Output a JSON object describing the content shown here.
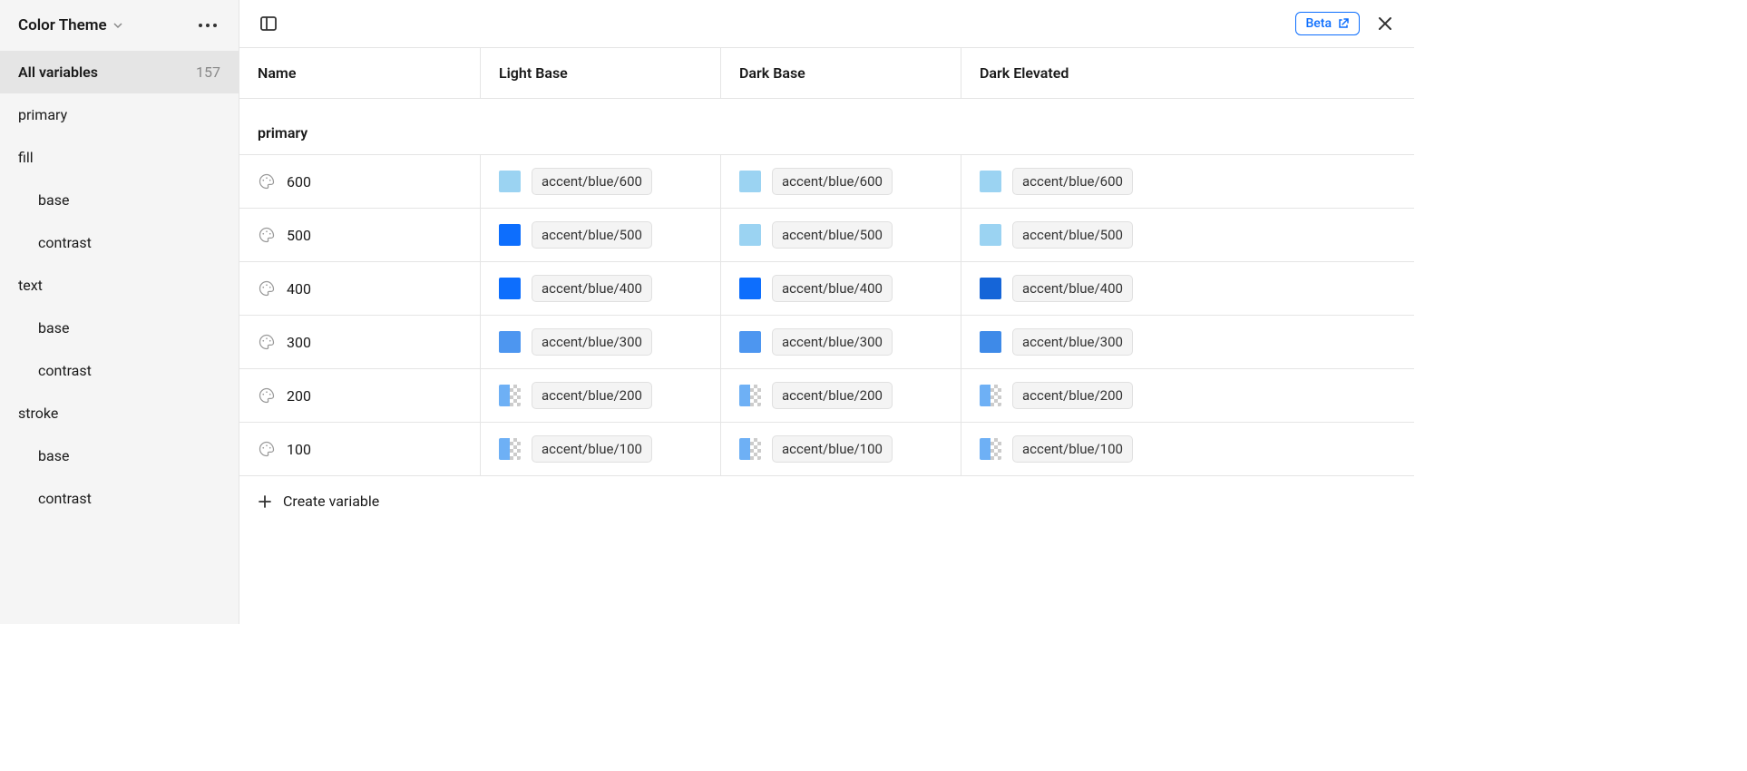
{
  "sidebar": {
    "title": "Color Theme",
    "allVariables": {
      "label": "All variables",
      "count": "157"
    },
    "groups": [
      {
        "label": "primary",
        "indent": 0
      },
      {
        "label": "fill",
        "indent": 0
      },
      {
        "label": "base",
        "indent": 1
      },
      {
        "label": "contrast",
        "indent": 1
      },
      {
        "label": "text",
        "indent": 0
      },
      {
        "label": "base",
        "indent": 1
      },
      {
        "label": "contrast",
        "indent": 1
      },
      {
        "label": "stroke",
        "indent": 0
      },
      {
        "label": "base",
        "indent": 1
      },
      {
        "label": "contrast",
        "indent": 1
      }
    ]
  },
  "topbar": {
    "beta": "Beta"
  },
  "table": {
    "columns": [
      "Name",
      "Light Base",
      "Dark Base",
      "Dark Elevated"
    ],
    "groupTitle": "primary",
    "createLabel": "Create variable",
    "rows": [
      {
        "name": "600",
        "modes": [
          {
            "color": "#9bd3f2",
            "alpha": false,
            "token": "accent/blue/600"
          },
          {
            "color": "#9bd3f2",
            "alpha": false,
            "token": "accent/blue/600"
          },
          {
            "color": "#9bd3f2",
            "alpha": false,
            "token": "accent/blue/600"
          }
        ]
      },
      {
        "name": "500",
        "modes": [
          {
            "color": "#0d6efd",
            "alpha": false,
            "token": "accent/blue/500"
          },
          {
            "color": "#9bd3f2",
            "alpha": false,
            "token": "accent/blue/500"
          },
          {
            "color": "#9bd3f2",
            "alpha": false,
            "token": "accent/blue/500"
          }
        ]
      },
      {
        "name": "400",
        "modes": [
          {
            "color": "#0d6efd",
            "alpha": false,
            "token": "accent/blue/400"
          },
          {
            "color": "#0d6efd",
            "alpha": false,
            "token": "accent/blue/400"
          },
          {
            "color": "#1565d8",
            "alpha": false,
            "token": "accent/blue/400"
          }
        ]
      },
      {
        "name": "300",
        "modes": [
          {
            "color": "#4d96f0",
            "alpha": false,
            "token": "accent/blue/300"
          },
          {
            "color": "#4d96f0",
            "alpha": false,
            "token": "accent/blue/300"
          },
          {
            "color": "#3e8ae8",
            "alpha": false,
            "token": "accent/blue/300"
          }
        ]
      },
      {
        "name": "200",
        "modes": [
          {
            "color": "#6eb0f5",
            "alpha": true,
            "token": "accent/blue/200"
          },
          {
            "color": "#6eb0f5",
            "alpha": true,
            "token": "accent/blue/200"
          },
          {
            "color": "#6eb0f5",
            "alpha": true,
            "token": "accent/blue/200"
          }
        ]
      },
      {
        "name": "100",
        "modes": [
          {
            "color": "#6eb0f5",
            "alpha": true,
            "token": "accent/blue/100"
          },
          {
            "color": "#6eb0f5",
            "alpha": true,
            "token": "accent/blue/100"
          },
          {
            "color": "#6eb0f5",
            "alpha": true,
            "token": "accent/blue/100"
          }
        ]
      }
    ]
  }
}
